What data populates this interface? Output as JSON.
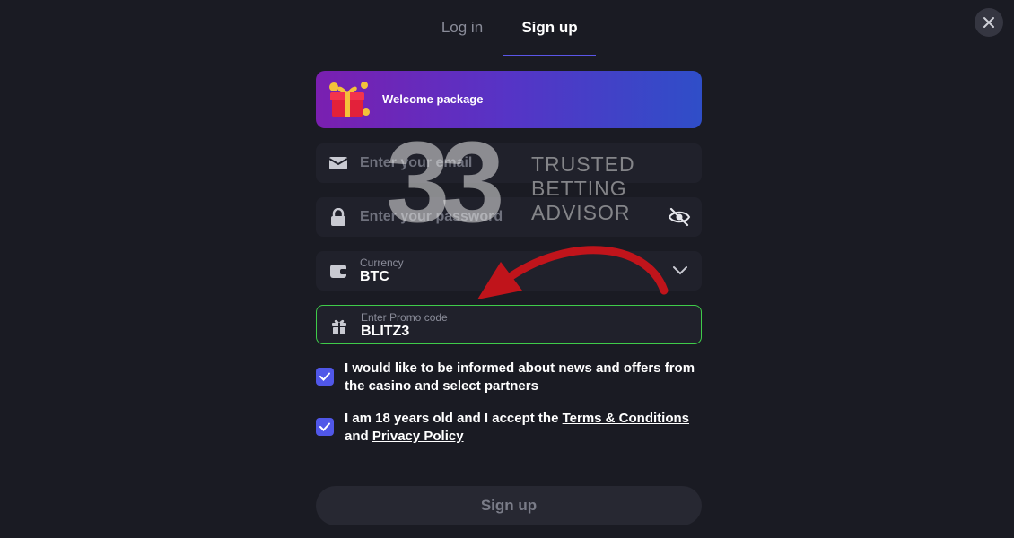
{
  "tabs": {
    "login_label": "Log in",
    "signup_label": "Sign up",
    "active": "signup"
  },
  "banner": {
    "text": "Welcome package"
  },
  "form": {
    "email": {
      "placeholder": "Enter your email",
      "value": ""
    },
    "password": {
      "placeholder": "Enter your password",
      "value": ""
    },
    "currency": {
      "label": "Currency",
      "value": "BTC"
    },
    "promo": {
      "label": "Enter Promo code",
      "value": "BLITZ3"
    }
  },
  "consents": {
    "news_text": "I would like to be informed about news and offers from the casino and select partners",
    "news_checked": true,
    "age_prefix": "I am 18 years old and I accept the ",
    "terms_link": "Terms & Conditions",
    "age_and": " and ",
    "privacy_link": "Privacy Policy",
    "age_checked": true
  },
  "submit_label": "Sign up",
  "watermark": {
    "logo": "33",
    "line1": "TRUSTED",
    "line2": "BETTING",
    "line3": "ADVISOR"
  },
  "colors": {
    "background": "#1a1b23",
    "accent": "#5b56e8",
    "checkbox": "#5057e8",
    "promo_border": "#3fcc4a",
    "arrow": "#c0141b"
  },
  "icons": {
    "close": "close-icon",
    "email": "envelope-icon",
    "password": "lock-icon",
    "toggle": "eye-slash-icon",
    "currency": "wallet-icon",
    "dropdown": "chevron-down-icon",
    "promo": "gift-icon",
    "check": "checkmark-icon"
  }
}
